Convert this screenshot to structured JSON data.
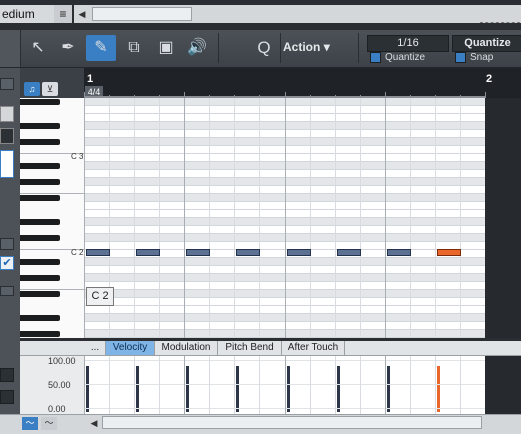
{
  "top": {
    "label": "edium",
    "menu_icon": "hamburger-icon",
    "scroll_left": "◀"
  },
  "toolbar": {
    "tools": [
      {
        "name": "arrow-tool",
        "icon": "↖"
      },
      {
        "name": "eyedropper-tool",
        "icon": "✒"
      },
      {
        "name": "draw-tool",
        "icon": "✎",
        "active": true
      },
      {
        "name": "range-tool",
        "icon": "⧉"
      },
      {
        "name": "mute-tool",
        "icon": "▣"
      },
      {
        "name": "speaker-tool",
        "icon": "🔊"
      }
    ],
    "q_label": "Q",
    "action_label": "Action",
    "action_arrow": "▾",
    "quantize_value": "1/16",
    "quantize_toggle_label": "Quantize",
    "quantize_button": "Quantize",
    "snap_label": "Snap"
  },
  "ruler": {
    "bar1": "1",
    "bar2": "2",
    "time_signature": "4/4"
  },
  "keyboard": {
    "c3_label": "C 3",
    "c2_label": "C 2"
  },
  "tooltip": "C 2",
  "notes": [
    {
      "step": 0,
      "pitch": "C 2",
      "velocity": 100
    },
    {
      "step": 2,
      "pitch": "C 2",
      "velocity": 100
    },
    {
      "step": 4,
      "pitch": "C 2",
      "velocity": 100
    },
    {
      "step": 6,
      "pitch": "C 2",
      "velocity": 100
    },
    {
      "step": 8,
      "pitch": "C 2",
      "velocity": 100
    },
    {
      "step": 10,
      "pitch": "C 2",
      "velocity": 100
    },
    {
      "step": 12,
      "pitch": "C 2",
      "velocity": 100
    },
    {
      "step": 14,
      "pitch": "C 2",
      "velocity": 100,
      "selected": true
    }
  ],
  "tabs": [
    "...",
    "Velocity",
    "Modulation",
    "Pitch Bend",
    "After Touch"
  ],
  "velocity_axis": [
    "100.00",
    "50.00",
    "0.00"
  ],
  "bottom": {
    "scroll_left": "◀"
  },
  "colors": {
    "accent": "#3a7fc4",
    "note": "#5d7192",
    "selected_note": "#e9672b"
  }
}
